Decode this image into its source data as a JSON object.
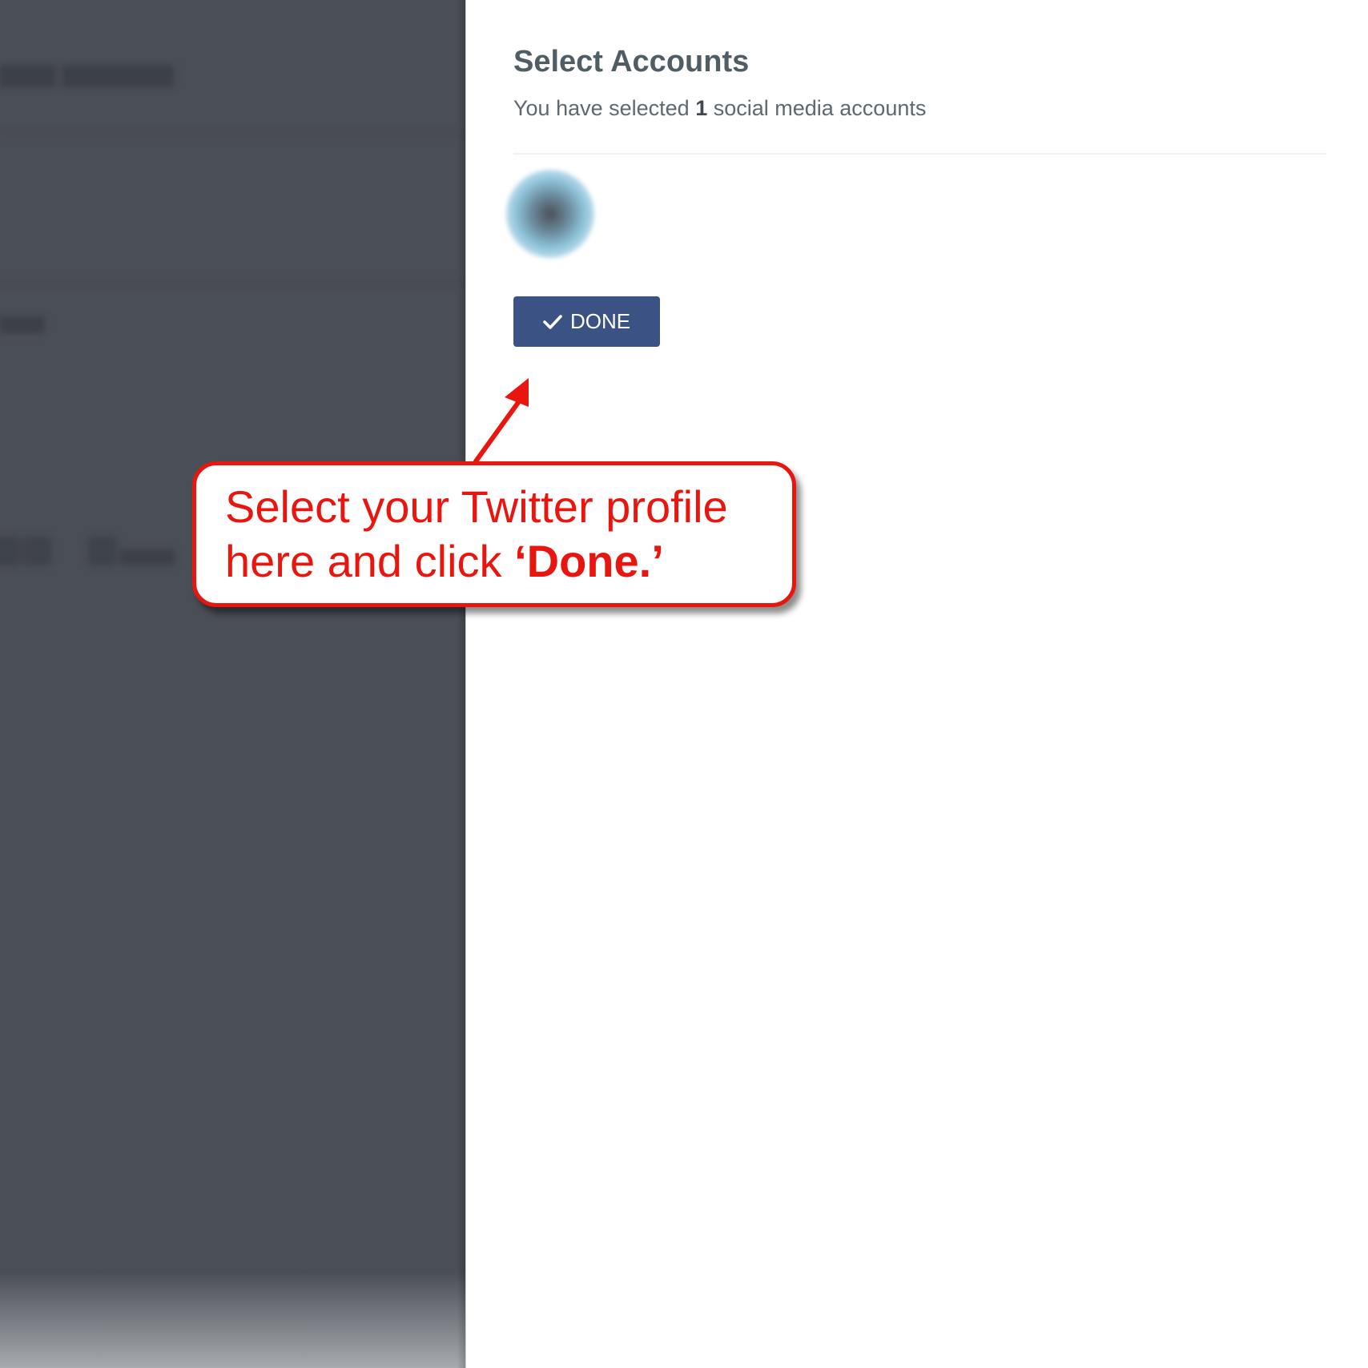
{
  "panel": {
    "title": "Select Accounts",
    "subtitle_prefix": "You have selected ",
    "selected_count": "1",
    "subtitle_suffix": " social media accounts",
    "done_label": "DONE"
  },
  "annotation": {
    "line1": "Select your Twitter profile",
    "line2_prefix": "here and click ",
    "line2_emphasis": "‘Done.’"
  },
  "icons": {
    "done_button_icon": "check-icon"
  },
  "colors": {
    "button": "#3b5285",
    "annotation": "#e8160f",
    "backdrop": "#4a4e55"
  }
}
